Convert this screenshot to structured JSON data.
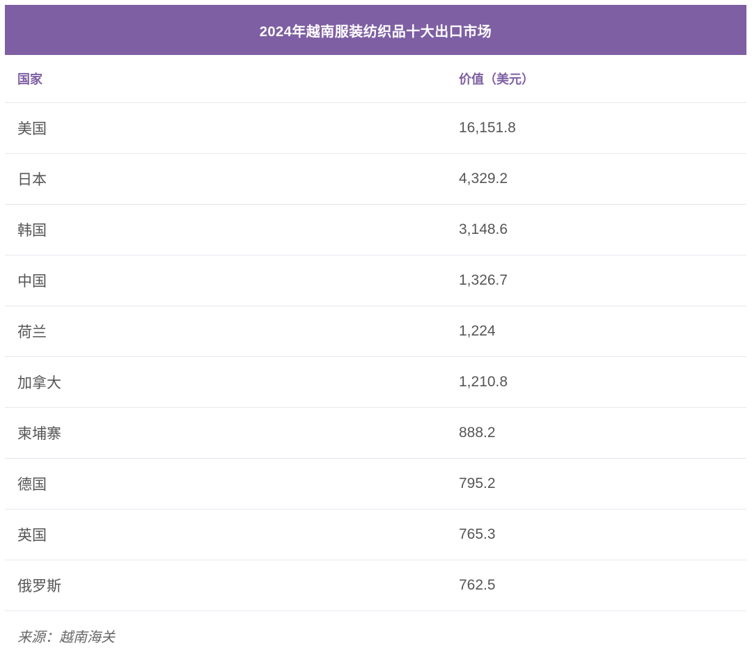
{
  "chart_data": {
    "type": "table",
    "title": "2024年越南服装纺织品十大出口市场",
    "columns": [
      "国家",
      "价值（美元）"
    ],
    "rows": [
      {
        "country": "美国",
        "value": "16,151.8"
      },
      {
        "country": "日本",
        "value": "4,329.2"
      },
      {
        "country": "韩国",
        "value": "3,148.6"
      },
      {
        "country": "中国",
        "value": "1,326.7"
      },
      {
        "country": "荷兰",
        "value": "1,224"
      },
      {
        "country": "加拿大",
        "value": "1,210.8"
      },
      {
        "country": "柬埔寨",
        "value": "888.2"
      },
      {
        "country": "德国",
        "value": "795.2"
      },
      {
        "country": "英国",
        "value": "765.3"
      },
      {
        "country": "俄罗斯",
        "value": "762.5"
      }
    ],
    "source": "来源：越南海关"
  },
  "colors": {
    "accent": "#7e5fa3",
    "text": "#555555",
    "divider": "#e9e6ee"
  }
}
